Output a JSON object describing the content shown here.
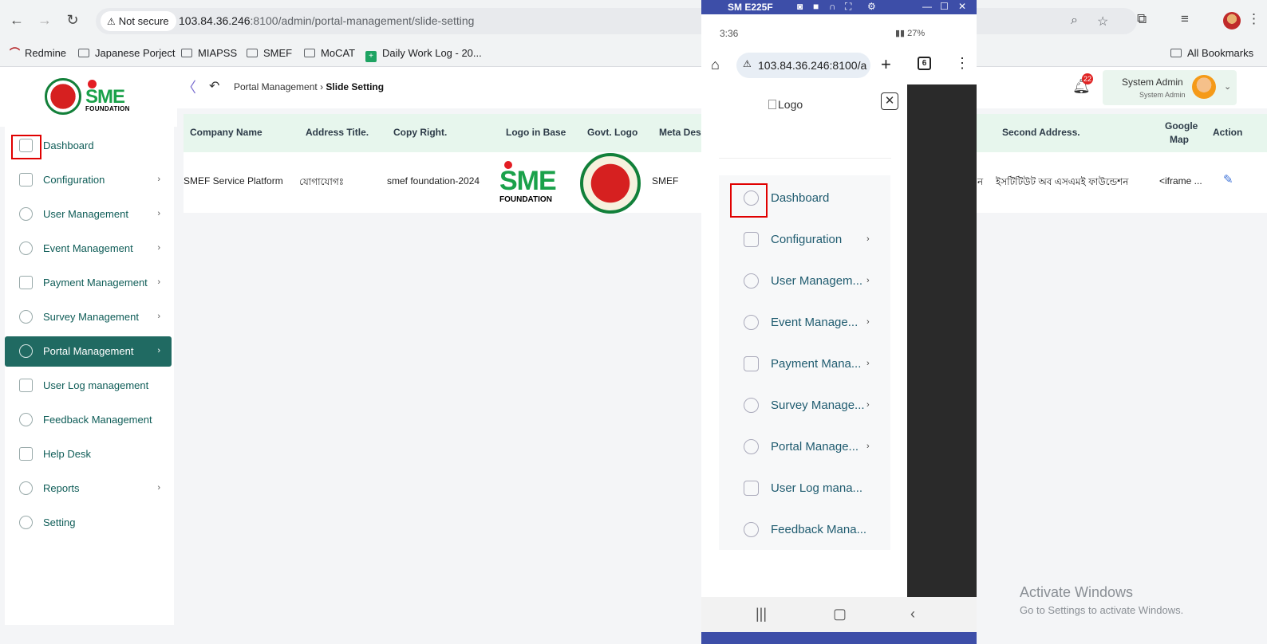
{
  "browser": {
    "not_secure": "Not secure",
    "url_host": "103.84.36.246",
    "url_rest": ":8100/admin/portal-management/slide-setting",
    "bookmarks": [
      "Redmine",
      "Japanese Porject",
      "MIAPSS",
      "SMEF",
      "MoCAT",
      "Daily Work Log - 20...",
      "All Bookmarks"
    ]
  },
  "logo": {
    "text": "SME",
    "sub": "FOUNDATION"
  },
  "topbar": {
    "breadcrumb_parent": "Portal Management",
    "breadcrumb_current": "Slide Setting",
    "notification_count": "22",
    "user_name": "System Admin",
    "user_role": "System Admin"
  },
  "sidebar": {
    "items": [
      {
        "label": "Dashboard",
        "chevron": ""
      },
      {
        "label": "Configuration",
        "chevron": "›"
      },
      {
        "label": "User Management",
        "chevron": "›"
      },
      {
        "label": "Event Management",
        "chevron": "›"
      },
      {
        "label": "Payment Management",
        "chevron": "›"
      },
      {
        "label": "Survey Management",
        "chevron": "›"
      },
      {
        "label": "Portal Management",
        "chevron": "›"
      },
      {
        "label": "User Log management",
        "chevron": ""
      },
      {
        "label": "Feedback Management",
        "chevron": ""
      },
      {
        "label": "Help Desk",
        "chevron": ""
      },
      {
        "label": "Reports",
        "chevron": "›"
      },
      {
        "label": "Setting",
        "chevron": ""
      }
    ]
  },
  "table": {
    "headers": [
      "Company Name",
      "Address Title.",
      "Copy Right.",
      "Logo in Base",
      "Govt. Logo",
      "Meta Des",
      "Second Address.",
      "Google",
      "Map",
      "Action"
    ],
    "row": {
      "company": "SMEF Service Platform",
      "address_title": "যোগাযোগঃ",
      "copyright": "smef foundation-2024",
      "logo_text": "SME",
      "logo_sub": "FOUNDATION",
      "meta": "SMEF",
      "partial": "ন",
      "second_address": "ইসটিটিউট অব এসএমই ফাউন্ডেশন",
      "map": "<iframe ..."
    }
  },
  "phone": {
    "window_title": "SM E225F",
    "time": "3:36",
    "status": "27%",
    "url": "103.84.36.246:8100/a",
    "tab_count": "6",
    "logo_alt": "Logo",
    "menu": [
      {
        "label": "Dashboard",
        "chevron": ""
      },
      {
        "label": "Configuration",
        "chevron": "›"
      },
      {
        "label": "User Managem...",
        "chevron": "›"
      },
      {
        "label": "Event Manage...",
        "chevron": "›"
      },
      {
        "label": "Payment Mana...",
        "chevron": "›"
      },
      {
        "label": "Survey Manage...",
        "chevron": "›"
      },
      {
        "label": "Portal Manage...",
        "chevron": "›"
      },
      {
        "label": "User Log mana...",
        "chevron": ""
      },
      {
        "label": "Feedback Mana...",
        "chevron": ""
      }
    ]
  },
  "watermark": {
    "line1": "Activate Windows",
    "line2": "Go to Settings to activate Windows."
  },
  "colors": {
    "primary": "#206a62",
    "header_bg": "#e7f6ed",
    "highlight": "#e00000"
  }
}
